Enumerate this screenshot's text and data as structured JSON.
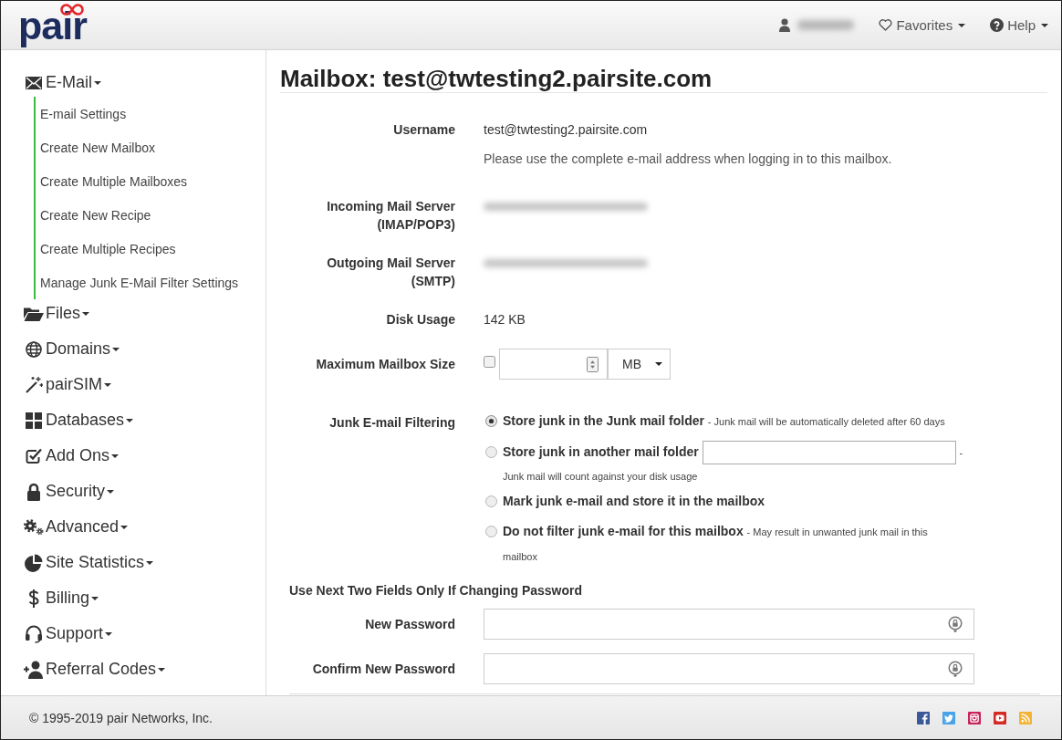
{
  "header": {
    "logo": "pair",
    "nav": [
      {
        "kind": "user"
      },
      {
        "kind": "menu",
        "label": "Favorites"
      },
      {
        "kind": "menu",
        "label": "Help"
      }
    ]
  },
  "sidebar": {
    "items": [
      {
        "label": "E-Mail",
        "expanded": true,
        "children": [
          {
            "label": "E-mail Settings"
          },
          {
            "label": "Create New Mailbox"
          },
          {
            "label": "Create Multiple Mailboxes"
          },
          {
            "label": "Create New Recipe"
          },
          {
            "label": "Create Multiple Recipes"
          },
          {
            "label": "Manage Junk E-Mail Filter Settings"
          }
        ]
      },
      {
        "label": "Files",
        "expanded": false
      },
      {
        "label": "Domains",
        "expanded": false
      },
      {
        "label": "pairSIM",
        "expanded": false
      },
      {
        "label": "Databases",
        "expanded": false
      },
      {
        "label": "Add Ons",
        "expanded": false
      },
      {
        "label": "Security",
        "expanded": false
      },
      {
        "label": "Advanced",
        "expanded": false
      },
      {
        "label": "Site Statistics",
        "expanded": false
      },
      {
        "label": "Billing",
        "expanded": false
      },
      {
        "label": "Support",
        "expanded": false
      },
      {
        "label": "Referral Codes",
        "expanded": false
      }
    ]
  },
  "main": {
    "title": "Mailbox: test@twtesting2.pairsite.com",
    "fields": [
      {
        "kind": "text",
        "label": "Username",
        "value": "test@twtesting2.pairsite.com",
        "help": "Please use the complete e-mail address when logging in to this mailbox."
      },
      {
        "kind": "blurred",
        "label": "Incoming Mail Server (IMAP/POP3)"
      },
      {
        "kind": "blurred",
        "label": "Outgoing Mail Server (SMTP)"
      },
      {
        "kind": "text",
        "label": "Disk Usage",
        "value": "142 KB"
      },
      {
        "kind": "size",
        "label": "Maximum Mailbox Size",
        "checked": false,
        "unit": "MB"
      },
      {
        "kind": "radios",
        "label": "Junk E-mail Filtering",
        "options": [
          {
            "kind": "plain",
            "label": "Store junk in the Junk mail folder",
            "note": "- Junk mail will be automatically deleted after 60 days",
            "selected": true
          },
          {
            "kind": "folder",
            "label": "Store junk in another mail folder",
            "note": "-",
            "note_below": "Junk mail will count against your disk usage",
            "selected": false
          },
          {
            "kind": "plain",
            "label": "Mark junk e-mail and store it in the mailbox",
            "selected": false
          },
          {
            "kind": "plain",
            "label": "Do not filter junk e-mail for this mailbox",
            "note": "- May result in unwanted junk mail in this mailbox",
            "selected": false
          }
        ]
      }
    ],
    "password_section": {
      "heading": "Use Next Two Fields Only If Changing Password",
      "fields": [
        {
          "label": "New Password"
        },
        {
          "label": "Confirm New Password"
        }
      ]
    }
  },
  "footer": {
    "copyright": "© 1995-2019 pair Networks, Inc."
  }
}
